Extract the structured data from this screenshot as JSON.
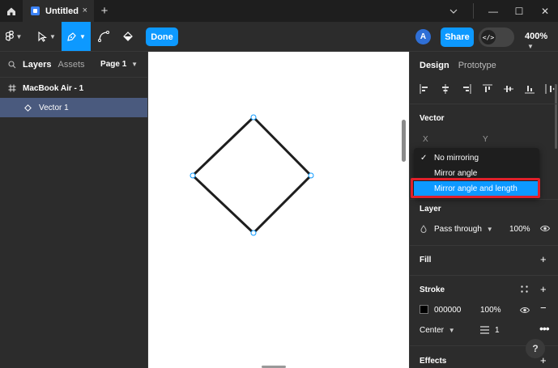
{
  "titlebar": {
    "tab_title": "Untitled",
    "tab_close": "×",
    "new_tab": "+",
    "win_minimize": "—",
    "win_maximize": "☐",
    "win_close": "✕",
    "chevron": "⌄"
  },
  "toolbar": {
    "done_label": "Done",
    "avatar_initial": "A",
    "share_label": "Share",
    "devmode_glyph": "</>",
    "zoom_label": "400%"
  },
  "left_panel": {
    "tabs": {
      "layers": "Layers",
      "assets": "Assets"
    },
    "page_label": "Page 1",
    "layers": [
      {
        "label": "MacBook Air - 1",
        "icon": "frame-icon"
      },
      {
        "label": "Vector 1",
        "icon": "vector-icon",
        "selected": true
      }
    ]
  },
  "right_panel": {
    "tabs": {
      "design": "Design",
      "prototype": "Prototype"
    },
    "vector_section": {
      "title": "Vector",
      "x_label": "X",
      "y_label": "Y"
    },
    "layer_section": {
      "title": "Layer",
      "blend_mode": "Pass through",
      "opacity": "100%"
    },
    "fill_section": {
      "title": "Fill"
    },
    "stroke_section": {
      "title": "Stroke",
      "color_hex": "000000",
      "opacity": "100%",
      "position": "Center",
      "weight": "1"
    },
    "effects_section": {
      "title": "Effects"
    },
    "help_label": "?"
  },
  "mirroring_menu": {
    "items": [
      {
        "label": "No mirroring",
        "checked": true
      },
      {
        "label": "Mirror angle",
        "checked": false
      },
      {
        "label": "Mirror angle and length",
        "checked": false,
        "highlighted": true
      }
    ],
    "check_glyph": "✓"
  },
  "colors": {
    "accent": "#0d99ff",
    "panel_bg": "#2c2c2c",
    "titlebar_bg": "#1e1e1e",
    "selected_layer": "#4a5a7e",
    "annotation_red": "#e0202a",
    "canvas_bg": "#ffffff"
  }
}
